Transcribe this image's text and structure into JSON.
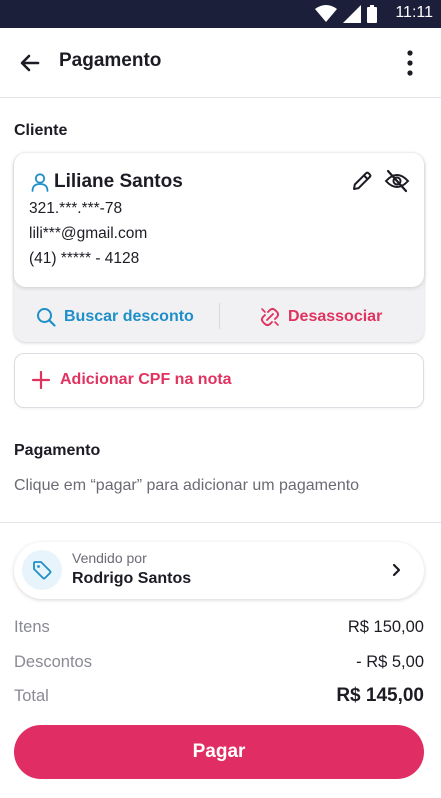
{
  "status_bar": {
    "time": "11:11",
    "icons": [
      "wifi-icon",
      "signal-icon",
      "battery-icon"
    ]
  },
  "app_bar": {
    "title": "Pagamento",
    "back_icon": "arrow-left-icon",
    "menu_icon": "more-vertical-icon"
  },
  "client": {
    "section_title": "Cliente",
    "name": "Liliane Santos",
    "cpf": "321.***.***-78",
    "email": "lili***@gmail.com",
    "phone": "(41) ***** - 4128",
    "actions": {
      "search_discount": "Buscar desconto",
      "disassociate": "Desassociar"
    }
  },
  "cpf_button": {
    "label": "Adicionar CPF na nota"
  },
  "payment": {
    "section_title": "Pagamento",
    "hint": "Clique em “pagar” para adicionar um pagamento"
  },
  "seller": {
    "caption": "Vendido por",
    "name": "Rodrigo Santos"
  },
  "summary": {
    "items_label": "Itens",
    "items_value": "R$ 150,00",
    "discounts_label": "Descontos",
    "discounts_value": "- R$ 5,00",
    "total_label": "Total",
    "total_value": "R$ 145,00"
  },
  "pay_button": {
    "label": "Pagar"
  },
  "colors": {
    "accent_pink": "#e02d63",
    "accent_blue": "#1e8fc8",
    "status_bar": "#1b1f3a"
  }
}
